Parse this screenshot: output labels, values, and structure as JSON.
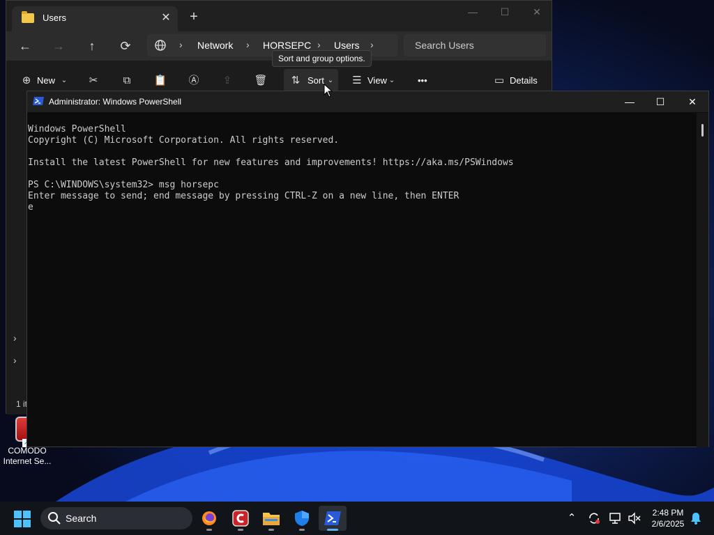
{
  "desktop": {
    "icons": [
      {
        "label": "COMODO Internet Se...",
        "icon": "comodo-icon"
      }
    ]
  },
  "explorer": {
    "tab_title": "Users",
    "tab_close": "✕",
    "new_tab": "+",
    "window_controls": {
      "minimize": "—",
      "maximize": "☐",
      "close": "✕"
    },
    "nav": {
      "back": "←",
      "forward": "→",
      "up": "↑",
      "refresh": "⟳"
    },
    "breadcrumbs": [
      "Network",
      "HORSEPC",
      "Users"
    ],
    "search_placeholder": "Search Users",
    "commands": {
      "new": "New",
      "sort": "Sort",
      "view": "View",
      "more": "•••",
      "details": "Details"
    },
    "tooltip": "Sort and group options.",
    "status": "1 it"
  },
  "powershell": {
    "title": "Administrator: Windows PowerShell",
    "window_controls": {
      "minimize": "—",
      "maximize": "☐",
      "close": "✕"
    },
    "lines": [
      "Windows PowerShell",
      "Copyright (C) Microsoft Corporation. All rights reserved.",
      "",
      "Install the latest PowerShell for new features and improvements! https://aka.ms/PSWindows",
      "",
      "PS C:\\WINDOWS\\system32> msg horsepc",
      "Enter message to send; end message by pressing CTRL-Z on a new line, then ENTER",
      "e"
    ]
  },
  "taskbar": {
    "search_label": "Search",
    "apps": [
      "firefox-icon",
      "comodo-icon",
      "file-explorer-icon",
      "windows-security-icon",
      "powershell-icon"
    ],
    "active_app": "powershell-icon",
    "clock": {
      "time": "2:48 PM",
      "date": "2/6/2025"
    }
  },
  "colors": {
    "console_bg": "#0c0c0c",
    "console_text": "#cccccc",
    "accent": "#5fb2f2",
    "taskbar_bg": "#111419"
  }
}
